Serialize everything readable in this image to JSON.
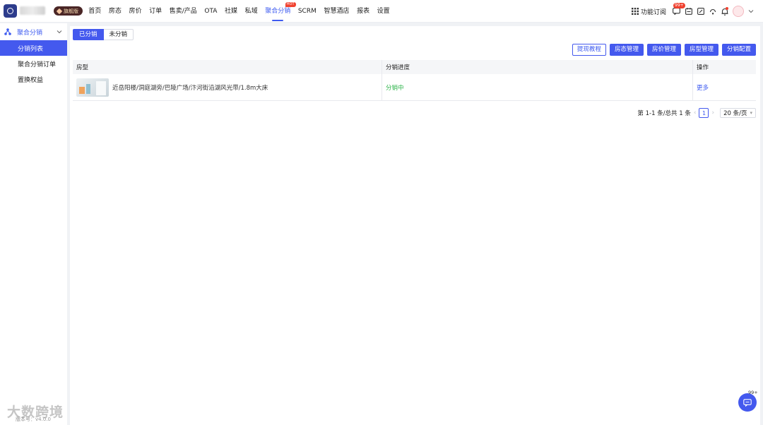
{
  "topbar": {
    "logo_text": "LOCALE",
    "edition_badge": "旗舰版",
    "nav": [
      {
        "label": "首页"
      },
      {
        "label": "房态"
      },
      {
        "label": "房价"
      },
      {
        "label": "订单"
      },
      {
        "label": "售卖/产品"
      },
      {
        "label": "OTA"
      },
      {
        "label": "社媒"
      },
      {
        "label": "私域"
      },
      {
        "label": "聚合分销",
        "active": true,
        "tag": "HOT"
      },
      {
        "label": "SCRM"
      },
      {
        "label": "智慧酒店"
      },
      {
        "label": "报表"
      },
      {
        "label": "设置"
      }
    ],
    "func_subscribe": "功能订阅",
    "message_badge": "99+"
  },
  "sidebar": {
    "group_label": "聚合分销",
    "items": [
      {
        "label": "分销列表",
        "active": true
      },
      {
        "label": "聚合分销订单"
      },
      {
        "label": "置换权益"
      }
    ]
  },
  "main": {
    "tabs": [
      {
        "label": "已分销",
        "active": true
      },
      {
        "label": "未分销"
      }
    ],
    "actions": [
      {
        "label": "提现教程",
        "style": "outline"
      },
      {
        "label": "房态管理",
        "style": "primary"
      },
      {
        "label": "房价管理",
        "style": "primary"
      },
      {
        "label": "房型管理",
        "style": "primary"
      },
      {
        "label": "分销配置",
        "style": "primary"
      }
    ],
    "table": {
      "headers": [
        "房型",
        "分销进度",
        "操作"
      ],
      "rows": [
        {
          "room": "近岳阳楼/洞庭湖旁/巴陵广场/汴河街沿湖风光带/1.8m大床",
          "status": "分销中",
          "action": "更多"
        }
      ]
    },
    "pager": {
      "summary": "第 1-1 条/总共 1 条",
      "current": "1",
      "page_size": "20 条/页"
    }
  },
  "footer": {
    "watermark": "大数跨境",
    "version": "版本号：v4.0.0"
  },
  "fab_badge": "99+",
  "colors": {
    "primary": "#4459ee",
    "success": "#2db44a",
    "hot": "#f0412f"
  }
}
